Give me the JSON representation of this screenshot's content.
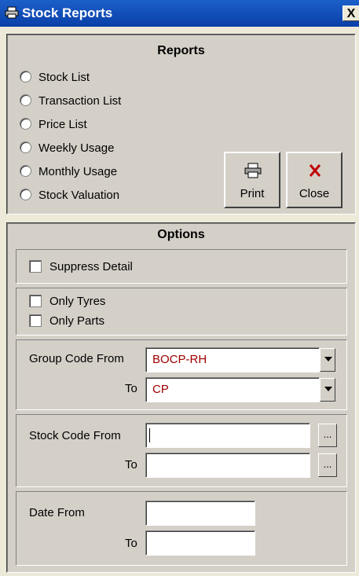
{
  "window": {
    "title": "Stock Reports",
    "close_glyph": "X"
  },
  "reports": {
    "heading": "Reports",
    "options": [
      {
        "label": "Stock List",
        "selected": false
      },
      {
        "label": "Transaction List",
        "selected": false
      },
      {
        "label": "Price List",
        "selected": false
      },
      {
        "label": "Weekly Usage",
        "selected": false
      },
      {
        "label": "Monthly Usage",
        "selected": false
      },
      {
        "label": "Stock Valuation",
        "selected": false
      }
    ],
    "print_label": "Print",
    "close_label": "Close",
    "print_icon": "printer-icon",
    "close_icon": "red-x-icon"
  },
  "options": {
    "heading": "Options",
    "suppress_detail": {
      "label": "Suppress Detail",
      "checked": false
    },
    "only_tyres": {
      "label": "Only Tyres",
      "checked": false
    },
    "only_parts": {
      "label": "Only Parts",
      "checked": false
    },
    "group_code_from_label": "Group Code From",
    "group_code_from_value": "BOCP-RH",
    "group_code_to_label": "To",
    "group_code_to_value": "CP",
    "stock_code_from_label": "Stock Code From",
    "stock_code_from_value": "",
    "stock_code_to_label": "To",
    "stock_code_to_value": "",
    "ellipsis": "...",
    "date_from_label": "Date From",
    "date_from_value": "",
    "date_to_label": "To",
    "date_to_value": ""
  },
  "colors": {
    "titlebar": "#0a3fa8",
    "dialog": "#d4d0c8",
    "field_text": "#a00000",
    "close_icon": "#c00000"
  }
}
